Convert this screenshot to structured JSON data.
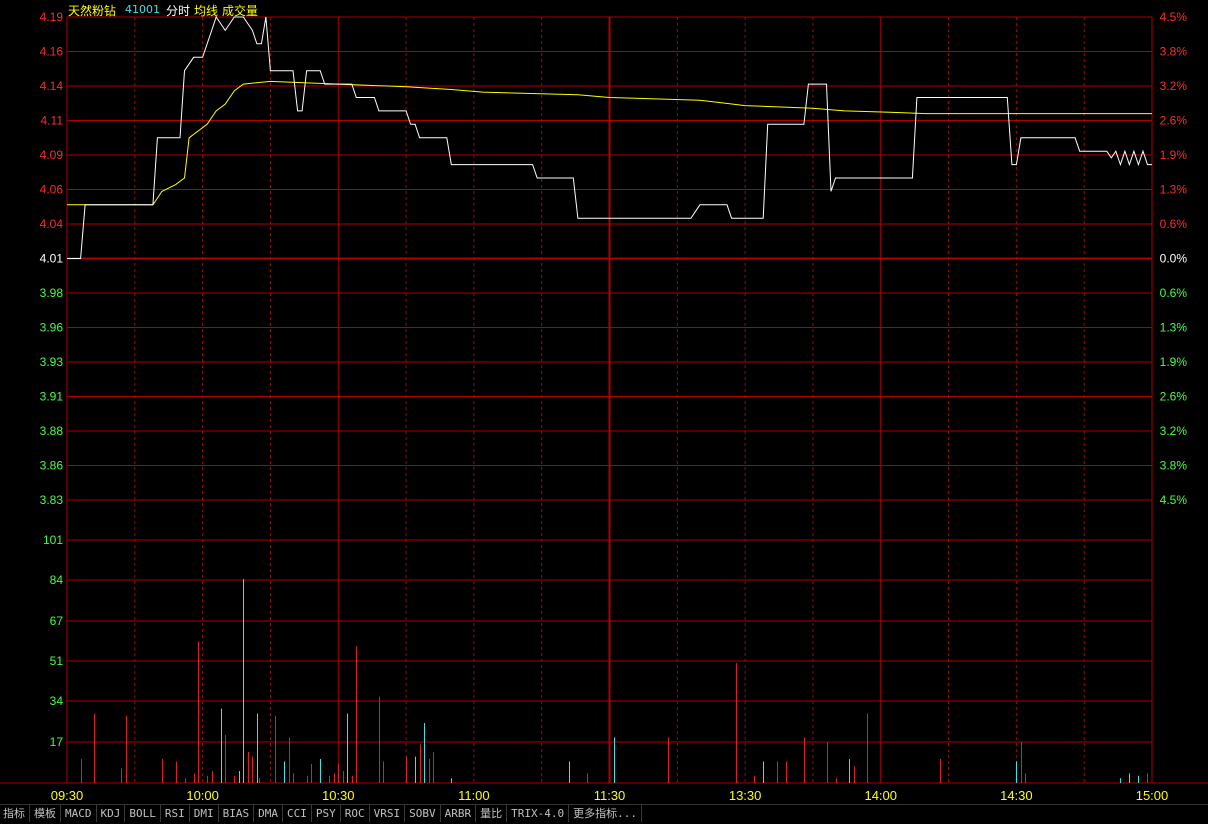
{
  "header": {
    "name": "天然粉钻",
    "code": "41001",
    "mode": "分时",
    "avg_label": "均线",
    "vol_label": "成交量"
  },
  "colors": {
    "price_line": "#ffffff",
    "avg_line": "#ffff00",
    "grid": "#b00000",
    "up": "#ff2a2a",
    "down": "#44ff44",
    "flat": "#ffffff",
    "volume_up": "#e02020",
    "volume_cyan": "#40e0e0",
    "time_label": "#ffff00"
  },
  "toolbar": [
    "指标",
    "模板",
    "MACD",
    "KDJ",
    "BOLL",
    "RSI",
    "DMI",
    "BIAS",
    "DMA",
    "CCI",
    "PSY",
    "ROC",
    "VRSI",
    "SOBV",
    "ARBR",
    "量比",
    "TRIX-4.0",
    "更多指标..."
  ],
  "chart_data": [
    {
      "type": "line",
      "title": "天然粉钻 41001 分时",
      "prev_close": 4.01,
      "ylim": [
        3.83,
        4.19
      ],
      "y_ticks": [
        {
          "label": "4.19",
          "pct": "4.5%",
          "dir": "up"
        },
        {
          "label": "4.16",
          "pct": "3.8%",
          "dir": "up"
        },
        {
          "label": "4.14",
          "pct": "3.2%",
          "dir": "up"
        },
        {
          "label": "4.11",
          "pct": "2.6%",
          "dir": "up"
        },
        {
          "label": "4.09",
          "pct": "1.9%",
          "dir": "up"
        },
        {
          "label": "4.06",
          "pct": "1.3%",
          "dir": "up"
        },
        {
          "label": "4.04",
          "pct": "0.6%",
          "dir": "up"
        },
        {
          "label": "4.01",
          "pct": "0.0%",
          "dir": "flat"
        },
        {
          "label": "3.98",
          "pct": "0.6%",
          "dir": "down"
        },
        {
          "label": "3.96",
          "pct": "1.3%",
          "dir": "down"
        },
        {
          "label": "3.93",
          "pct": "1.9%",
          "dir": "down"
        },
        {
          "label": "3.91",
          "pct": "2.6%",
          "dir": "down"
        },
        {
          "label": "3.88",
          "pct": "3.2%",
          "dir": "down"
        },
        {
          "label": "3.86",
          "pct": "3.8%",
          "dir": "down"
        },
        {
          "label": "3.83",
          "pct": "4.5%",
          "dir": "down"
        }
      ],
      "x_ticks": [
        "09:30",
        "10:00",
        "10:30",
        "11:00",
        "11:30",
        "13:30",
        "14:00",
        "14:30",
        "15:00"
      ],
      "series": [
        {
          "name": "分时",
          "points": [
            [
              0,
              4.01
            ],
            [
              3,
              4.01
            ],
            [
              4,
              4.05
            ],
            [
              19,
              4.05
            ],
            [
              20,
              4.1
            ],
            [
              25,
              4.1
            ],
            [
              26,
              4.15
            ],
            [
              28,
              4.16
            ],
            [
              30,
              4.16
            ],
            [
              32,
              4.18
            ],
            [
              33,
              4.19
            ],
            [
              35,
              4.18
            ],
            [
              37,
              4.19
            ],
            [
              39,
              4.19
            ],
            [
              41,
              4.18
            ],
            [
              42,
              4.17
            ],
            [
              43,
              4.17
            ],
            [
              44,
              4.19
            ],
            [
              45,
              4.15
            ],
            [
              50,
              4.15
            ],
            [
              51,
              4.12
            ],
            [
              52,
              4.12
            ],
            [
              53,
              4.15
            ],
            [
              56,
              4.15
            ],
            [
              57,
              4.14
            ],
            [
              63,
              4.14
            ],
            [
              64,
              4.13
            ],
            [
              68,
              4.13
            ],
            [
              69,
              4.12
            ],
            [
              75,
              4.12
            ],
            [
              76,
              4.11
            ],
            [
              77,
              4.11
            ],
            [
              78,
              4.1
            ],
            [
              84,
              4.1
            ],
            [
              85,
              4.08
            ],
            [
              103,
              4.08
            ],
            [
              104,
              4.07
            ],
            [
              112,
              4.07
            ],
            [
              113,
              4.04
            ],
            [
              138,
              4.04
            ],
            [
              140,
              4.05
            ],
            [
              146,
              4.05
            ],
            [
              147,
              4.04
            ],
            [
              154,
              4.04
            ],
            [
              155,
              4.11
            ],
            [
              163,
              4.11
            ],
            [
              164,
              4.14
            ],
            [
              168,
              4.14
            ],
            [
              169,
              4.06
            ],
            [
              170,
              4.07
            ],
            [
              187,
              4.07
            ],
            [
              188,
              4.13
            ],
            [
              208,
              4.13
            ],
            [
              209,
              4.08
            ],
            [
              210,
              4.08
            ],
            [
              211,
              4.1
            ],
            [
              223,
              4.1
            ],
            [
              224,
              4.09
            ],
            [
              230,
              4.09
            ],
            [
              231,
              4.085
            ],
            [
              232,
              4.09
            ],
            [
              233,
              4.08
            ],
            [
              234,
              4.09
            ],
            [
              235,
              4.08
            ],
            [
              236,
              4.09
            ],
            [
              237,
              4.08
            ],
            [
              238,
              4.09
            ],
            [
              239,
              4.08
            ],
            [
              240,
              4.08
            ]
          ]
        },
        {
          "name": "均线",
          "points": [
            [
              0,
              4.05
            ],
            [
              19,
              4.05
            ],
            [
              21,
              4.06
            ],
            [
              24,
              4.065
            ],
            [
              26,
              4.07
            ],
            [
              27,
              4.1
            ],
            [
              29,
              4.105
            ],
            [
              31,
              4.11
            ],
            [
              33,
              4.12
            ],
            [
              35,
              4.125
            ],
            [
              37,
              4.135
            ],
            [
              39,
              4.14
            ],
            [
              45,
              4.142
            ],
            [
              60,
              4.14
            ],
            [
              75,
              4.138
            ],
            [
              85,
              4.136
            ],
            [
              92,
              4.134
            ],
            [
              113,
              4.132
            ],
            [
              120,
              4.13
            ],
            [
              140,
              4.128
            ],
            [
              145,
              4.126
            ],
            [
              150,
              4.124
            ],
            [
              165,
              4.122
            ],
            [
              172,
              4.12
            ],
            [
              182,
              4.119
            ],
            [
              190,
              4.118
            ],
            [
              210,
              4.118
            ],
            [
              220,
              4.118
            ],
            [
              240,
              4.118
            ]
          ]
        }
      ]
    },
    {
      "type": "bar",
      "title": "成交量",
      "ylim": [
        0,
        118
      ],
      "y_ticks": [
        "101",
        "84",
        "67",
        "51",
        "34",
        "17"
      ],
      "bars": [
        [
          3,
          10,
          "r"
        ],
        [
          6,
          29,
          "r"
        ],
        [
          12,
          6,
          "r"
        ],
        [
          13,
          28,
          "r"
        ],
        [
          21,
          10,
          "r"
        ],
        [
          24,
          9,
          "r"
        ],
        [
          26,
          2,
          "r"
        ],
        [
          28,
          4,
          "r"
        ],
        [
          29,
          59,
          "r"
        ],
        [
          31,
          3,
          "r"
        ],
        [
          32,
          5,
          "r"
        ],
        [
          34,
          31,
          "c"
        ],
        [
          35,
          20,
          "r"
        ],
        [
          37,
          3,
          "r"
        ],
        [
          38,
          5,
          "c"
        ],
        [
          39,
          85,
          "c"
        ],
        [
          40,
          13,
          "r"
        ],
        [
          41,
          11,
          "r"
        ],
        [
          42,
          29,
          "c"
        ],
        [
          42.5,
          2,
          "r"
        ],
        [
          46,
          28,
          "r"
        ],
        [
          48,
          9,
          "c"
        ],
        [
          49,
          19,
          "r"
        ],
        [
          50,
          4,
          "r"
        ],
        [
          53,
          3,
          "r"
        ],
        [
          54,
          8,
          "r"
        ],
        [
          56,
          10,
          "c"
        ],
        [
          58,
          3,
          "r"
        ],
        [
          59,
          4,
          "r"
        ],
        [
          60,
          8,
          "r"
        ],
        [
          61,
          5,
          "r"
        ],
        [
          62,
          29,
          "c"
        ],
        [
          63,
          3,
          "r"
        ],
        [
          64,
          57,
          "r"
        ],
        [
          69,
          36,
          "r"
        ],
        [
          70,
          9,
          "r"
        ],
        [
          75,
          11,
          "r"
        ],
        [
          77,
          11,
          "c"
        ],
        [
          78,
          16,
          "r"
        ],
        [
          79,
          25,
          "c"
        ],
        [
          80,
          10,
          "r"
        ],
        [
          81,
          13,
          "r"
        ],
        [
          85,
          2,
          "c"
        ],
        [
          111,
          9,
          "c"
        ],
        [
          115,
          4,
          "r"
        ],
        [
          121,
          19,
          "c"
        ],
        [
          133,
          19,
          "r"
        ],
        [
          148,
          50,
          "r"
        ],
        [
          152,
          3,
          "r"
        ],
        [
          154,
          9,
          "c"
        ],
        [
          157,
          9,
          "r"
        ],
        [
          159,
          9,
          "r"
        ],
        [
          163,
          19,
          "r"
        ],
        [
          168,
          17,
          "r"
        ],
        [
          170,
          2,
          "r"
        ],
        [
          173,
          10,
          "c"
        ],
        [
          174,
          7,
          "r"
        ],
        [
          177,
          29,
          "r"
        ],
        [
          193,
          10,
          "r"
        ],
        [
          210,
          9,
          "c"
        ],
        [
          211,
          17,
          "r"
        ],
        [
          212,
          4,
          "r"
        ],
        [
          233,
          2,
          "c"
        ],
        [
          235,
          4,
          "c"
        ],
        [
          237,
          3,
          "c"
        ],
        [
          239,
          4,
          "r"
        ]
      ]
    }
  ]
}
